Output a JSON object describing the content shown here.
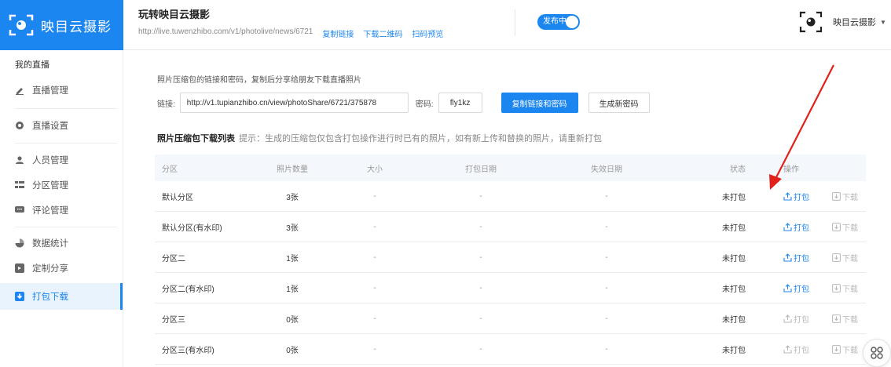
{
  "brand": {
    "name": "映目云摄影"
  },
  "header": {
    "title": "玩转映目云摄影",
    "url": "http://live.tuwenzhibo.com/v1/photolive/news/6721",
    "links": [
      "复制链接",
      "下载二维码",
      "扫码预览"
    ],
    "publish_toggle": "发布中",
    "user_name": "映目云摄影",
    "user_caret": "▼"
  },
  "sidebar": {
    "section_label": "我的直播",
    "items": [
      {
        "label": "直播管理",
        "icon": "pencil-icon"
      },
      {
        "label": "直播设置",
        "icon": "gear-icon"
      },
      {
        "label": "人员管理",
        "icon": "user-icon"
      },
      {
        "label": "分区管理",
        "icon": "list-icon"
      },
      {
        "label": "评论管理",
        "icon": "comment-icon"
      },
      {
        "label": "数据统计",
        "icon": "pie-chart-icon"
      },
      {
        "label": "定制分享",
        "icon": "share-icon"
      },
      {
        "label": "打包下载",
        "icon": "download-icon",
        "active": true
      }
    ]
  },
  "share": {
    "description": "照片压缩包的链接和密码，复制后分享给朋友下载直播照片",
    "link_label": "链接:",
    "link_value": "http://v1.tupianzhibo.cn/view/photoShare/6721/375878",
    "password_label": "密码:",
    "password_value": "fly1kz",
    "copy_button": "复制链接和密码",
    "new_password_button": "生成新密码"
  },
  "list": {
    "title": "照片压缩包下载列表",
    "hint": "提示：生成的压缩包仅包含打包操作进行时已有的照片，如有新上传和替换的照片，请重新打包",
    "columns": [
      "分区",
      "照片数量",
      "大小",
      "打包日期",
      "失效日期",
      "状态",
      "操作"
    ],
    "rows": [
      {
        "name": "默认分区",
        "count": "3张",
        "size": "-",
        "pack_date": "-",
        "expire_date": "-",
        "status": "未打包",
        "pack": "打包",
        "download": "下载",
        "pack_enabled": true
      },
      {
        "name": "默认分区(有水印)",
        "count": "3张",
        "size": "-",
        "pack_date": "-",
        "expire_date": "-",
        "status": "未打包",
        "pack": "打包",
        "download": "下载",
        "pack_enabled": true
      },
      {
        "name": "分区二",
        "count": "1张",
        "size": "-",
        "pack_date": "-",
        "expire_date": "-",
        "status": "未打包",
        "pack": "打包",
        "download": "下载",
        "pack_enabled": true
      },
      {
        "name": "分区二(有水印)",
        "count": "1张",
        "size": "-",
        "pack_date": "-",
        "expire_date": "-",
        "status": "未打包",
        "pack": "打包",
        "download": "下载",
        "pack_enabled": true
      },
      {
        "name": "分区三",
        "count": "0张",
        "size": "-",
        "pack_date": "-",
        "expire_date": "-",
        "status": "未打包",
        "pack": "打包",
        "download": "下载",
        "pack_enabled": false
      },
      {
        "name": "分区三(有水印)",
        "count": "0张",
        "size": "-",
        "pack_date": "-",
        "expire_date": "-",
        "status": "未打包",
        "pack": "打包",
        "download": "下载",
        "pack_enabled": false
      }
    ]
  },
  "colors": {
    "primary": "#1c86f0",
    "annotation_arrow": "#e0221b"
  }
}
